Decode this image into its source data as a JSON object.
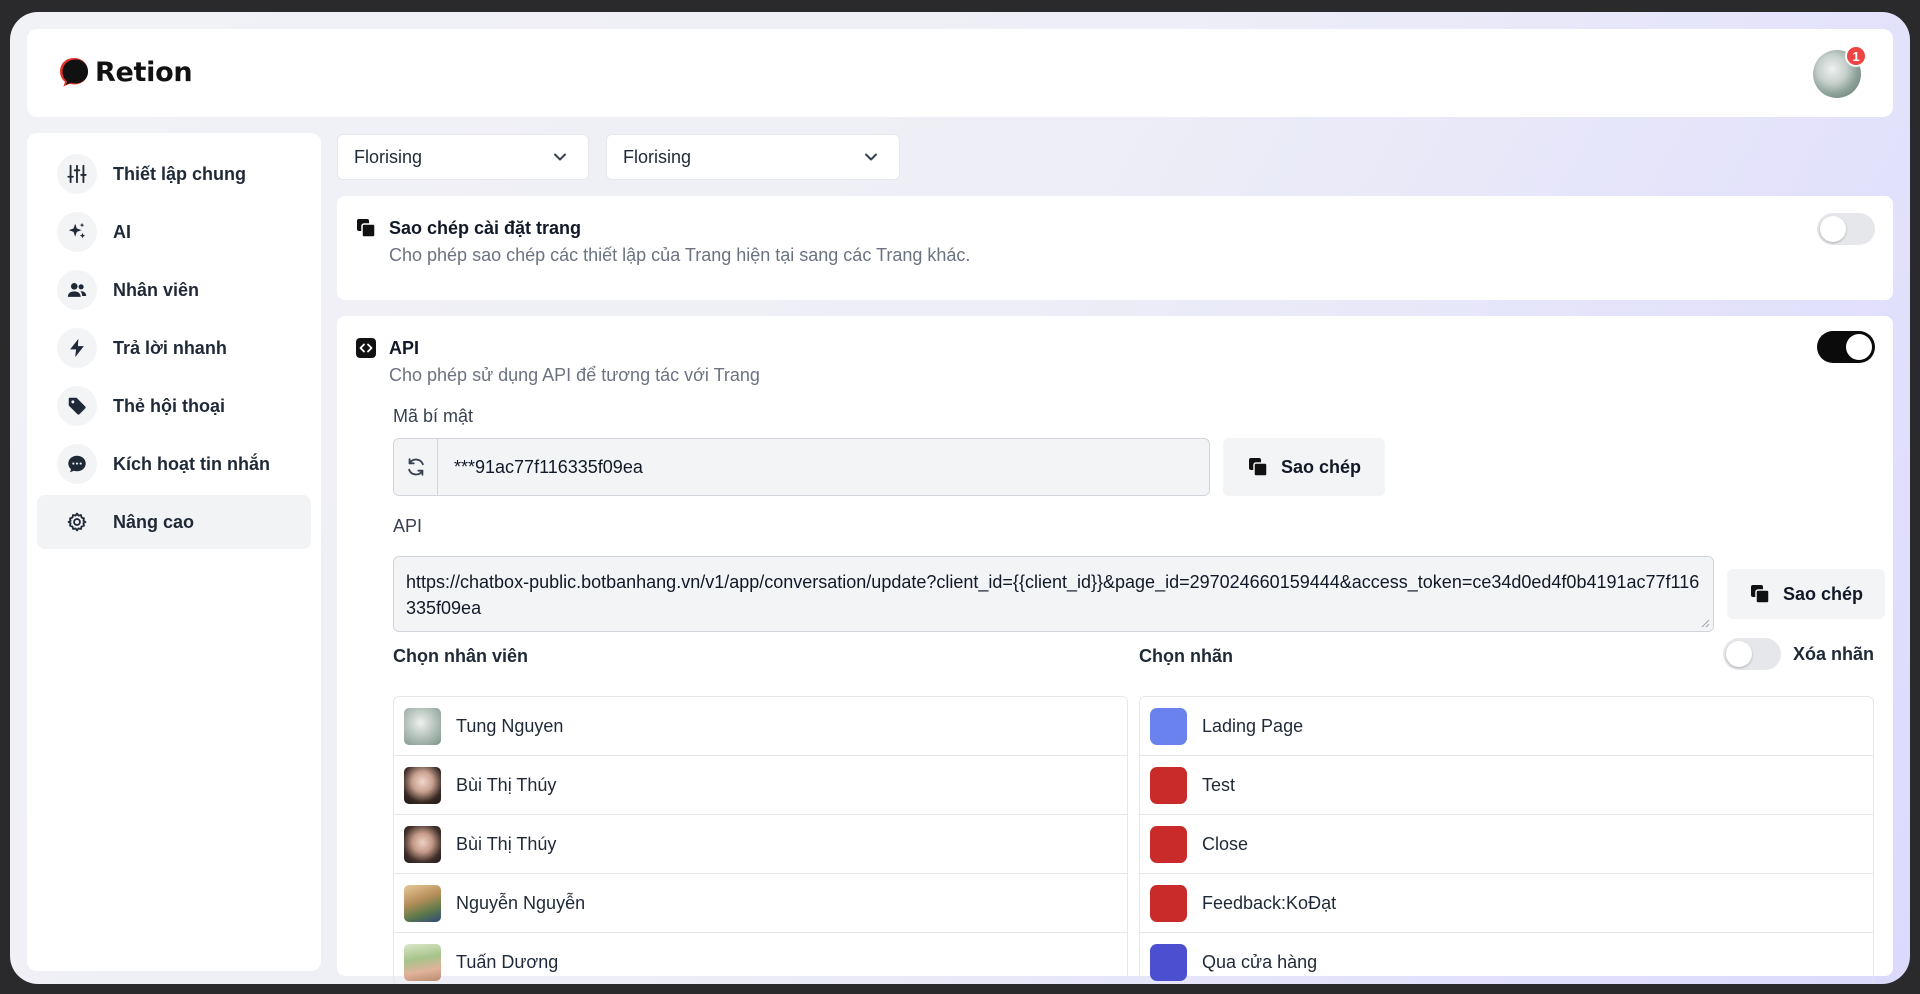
{
  "app": {
    "name": "Retion",
    "notification_count": "1"
  },
  "sidebar": {
    "items": [
      {
        "label": "Thiết lập chung",
        "icon": "sliders-icon"
      },
      {
        "label": "AI",
        "icon": "sparkles-icon"
      },
      {
        "label": "Nhân viên",
        "icon": "users-icon"
      },
      {
        "label": "Trả lời nhanh",
        "icon": "bolt-icon"
      },
      {
        "label": "Thẻ hội thoại",
        "icon": "tag-icon"
      },
      {
        "label": "Kích hoạt tin nhắn",
        "icon": "chat-bubble-icon"
      },
      {
        "label": "Nâng cao",
        "icon": "gear-icon",
        "active": true
      }
    ]
  },
  "filters": {
    "select_1": "Florising",
    "select_2": "Florising"
  },
  "copy_settings": {
    "title": "Sao chép cài đặt trang",
    "description": "Cho phép sao chép các thiết lập của Trang hiện tại sang các Trang khác.",
    "enabled": false
  },
  "api": {
    "title": "API",
    "description": "Cho phép sử dụng API để tương tác với Trang",
    "enabled": true,
    "secret_label": "Mã bí mật",
    "secret_value": "***91ac77f116335f09ea",
    "copy_label": "Sao chép",
    "api_label": "API",
    "api_url": "https://chatbox-public.botbanhang.vn/v1/app/conversation/update?client_id={{client_id}}&page_id=297024660159444&access_token=ce34d0ed4f0b4191ac77f116335f09ea",
    "api_copy_label": "Sao chép"
  },
  "staff": {
    "title": "Chọn nhân viên",
    "items": [
      {
        "name": "Tung Nguyen"
      },
      {
        "name": "Bùi Thị Thúy"
      },
      {
        "name": "Bùi Thị Thúy"
      },
      {
        "name": "Nguyễn Nguyễn"
      },
      {
        "name": "Tuấn Dương"
      }
    ]
  },
  "labels": {
    "title": "Chọn nhãn",
    "clear_label": "Xóa nhãn",
    "clear_enabled": false,
    "items": [
      {
        "name": "Lading Page",
        "color": "#6a82ee"
      },
      {
        "name": "Test",
        "color": "#c92a2a"
      },
      {
        "name": "Close",
        "color": "#c92a2a"
      },
      {
        "name": "Feedback:KoĐạt",
        "color": "#c92a2a"
      },
      {
        "name": "Qua cửa hàng",
        "color": "#4c4fd0"
      }
    ]
  }
}
